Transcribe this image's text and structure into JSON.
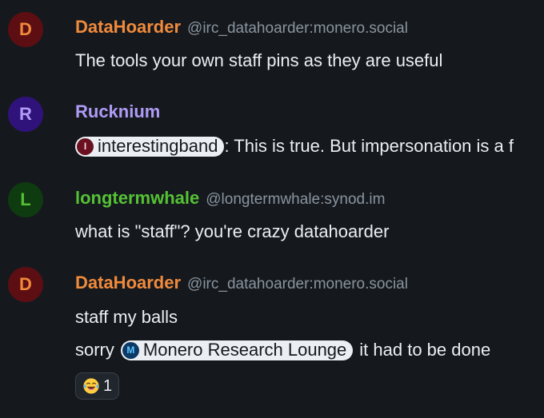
{
  "messages": [
    {
      "sender": "DataHoarder",
      "mxid": "@irc_datahoarder:monero.social",
      "avatar_letter": "D",
      "sender_color": "#f08a3c",
      "avatar_bg": "#5d0e12",
      "avatar_fg": "#f08a3c",
      "body": "The tools your own staff pins as they are useful"
    },
    {
      "sender": "Rucknium",
      "avatar_letter": "R",
      "sender_color": "#b09bf5",
      "avatar_bg": "#30137a",
      "avatar_fg": "#b09bf5",
      "mention": {
        "avatar_letter": "I",
        "label": "interestingband"
      },
      "body_after": ": This is true. But impersonation is a f"
    },
    {
      "sender": "longtermwhale",
      "mxid": "@longtermwhale:synod.im",
      "avatar_letter": "L",
      "sender_color": "#55c234",
      "avatar_bg": "#0f3b10",
      "avatar_fg": "#55c234",
      "body": "what is \"staff\"? you're crazy datahoarder"
    },
    {
      "sender": "DataHoarder",
      "mxid": "@irc_datahoarder:monero.social",
      "avatar_letter": "D",
      "sender_color": "#f08a3c",
      "avatar_bg": "#5d0e12",
      "avatar_fg": "#f08a3c",
      "body": "staff my balls",
      "body2_before": "sorry",
      "room_pill": {
        "avatar_letter": "M",
        "label": "Monero Research Lounge"
      },
      "body2_after": "it had to be done",
      "reaction": {
        "emoji": "face-with-tears-of-joy-icon",
        "count": "1"
      }
    }
  ]
}
